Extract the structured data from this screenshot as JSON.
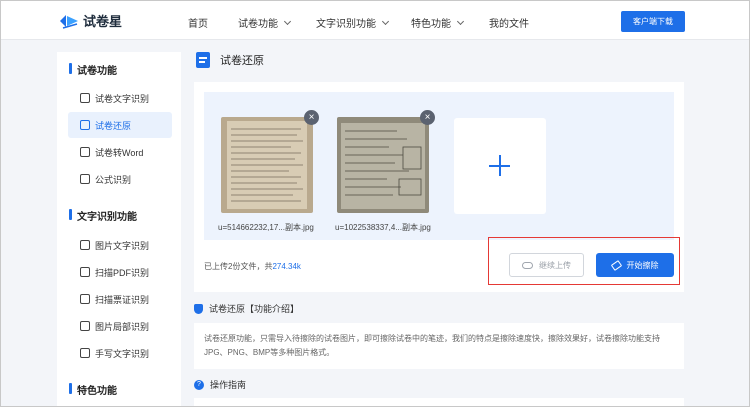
{
  "header": {
    "logo_text": "试卷星",
    "nav": [
      {
        "label": "首页",
        "has_dropdown": false
      },
      {
        "label": "试卷功能",
        "has_dropdown": true
      },
      {
        "label": "文字识别功能",
        "has_dropdown": true
      },
      {
        "label": "特色功能",
        "has_dropdown": true
      },
      {
        "label": "我的文件",
        "has_dropdown": false
      }
    ],
    "download_label": "客户端下载"
  },
  "sidebar": {
    "sections": [
      {
        "title": "试卷功能",
        "items": [
          {
            "label": "试卷文字识别",
            "icon": "document-text-icon"
          },
          {
            "label": "试卷还原",
            "icon": "document-restore-icon",
            "active": true
          },
          {
            "label": "试卷转Word",
            "icon": "word-icon"
          },
          {
            "label": "公式识别",
            "icon": "formula-icon"
          }
        ]
      },
      {
        "title": "文字识别功能",
        "items": [
          {
            "label": "图片文字识别",
            "icon": "image-text-icon"
          },
          {
            "label": "扫描PDF识别",
            "icon": "pdf-scan-icon"
          },
          {
            "label": "扫描票证识别",
            "icon": "ticket-scan-icon"
          },
          {
            "label": "图片局部识别",
            "icon": "image-crop-icon"
          },
          {
            "label": "手写文字识别",
            "icon": "handwriting-icon"
          }
        ]
      },
      {
        "title": "特色功能",
        "items": []
      }
    ]
  },
  "main": {
    "title": "试卷还原",
    "files": [
      {
        "name": "u=514662232,17...副本.jpg"
      },
      {
        "name": "u=1022538337,4...副本.jpg"
      }
    ],
    "summary_prefix": "已上传2份文件，共",
    "summary_size": "274.34k",
    "continue_label": "继续上传",
    "start_label": "开始擦除",
    "intro_title": "试卷还原【功能介绍】",
    "intro_text": "试卷还原功能，只需导入待擦除的试卷图片，即可擦除试卷中的笔迹，我们的特点是擦除速度快，擦除效果好，试卷擦除功能支持JPG、PNG、BMP等多种图片格式。",
    "guide_title": "操作指南"
  },
  "colors": {
    "accent": "#1e6fe8",
    "highlight_border": "#e53935"
  }
}
